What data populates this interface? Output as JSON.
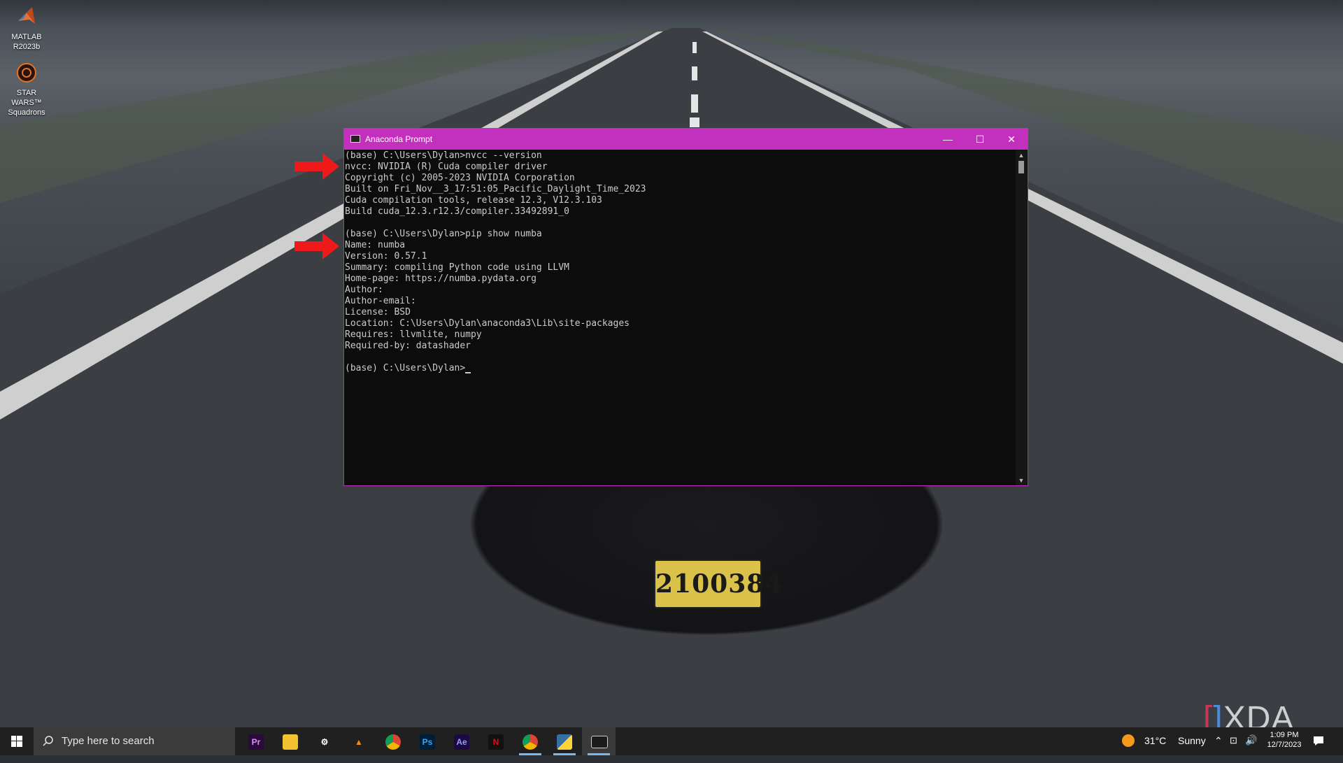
{
  "desktop": {
    "icons": [
      {
        "line1": "MATLAB",
        "line2": "R2023b"
      },
      {
        "line1": "STAR WARS™",
        "line2": "Squadrons"
      }
    ],
    "plate_number": "2100384"
  },
  "window": {
    "title": "Anaconda Prompt",
    "controls": {
      "minimize": "—",
      "maximize": "☐",
      "close": "✕"
    },
    "console_lines": [
      "(base) C:\\Users\\Dylan>nvcc --version",
      "nvcc: NVIDIA (R) Cuda compiler driver",
      "Copyright (c) 2005-2023 NVIDIA Corporation",
      "Built on Fri_Nov__3_17:51:05_Pacific_Daylight_Time_2023",
      "Cuda compilation tools, release 12.3, V12.3.103",
      "Build cuda_12.3.r12.3/compiler.33492891_0",
      "",
      "(base) C:\\Users\\Dylan>pip show numba",
      "Name: numba",
      "Version: 0.57.1",
      "Summary: compiling Python code using LLVM",
      "Home-page: https://numba.pydata.org",
      "Author:",
      "Author-email:",
      "License: BSD",
      "Location: C:\\Users\\Dylan\\anaconda3\\Lib\\site-packages",
      "Requires: llvmlite, numpy",
      "Required-by: datashader",
      "",
      "(base) C:\\Users\\Dylan>"
    ]
  },
  "watermark": "XDA",
  "taskbar": {
    "search_placeholder": "Type here to search",
    "apps": [
      {
        "name": "premiere",
        "label": "Pr",
        "color": "#2a0a3a",
        "fg": "#e08cff"
      },
      {
        "name": "file-explorer",
        "label": "",
        "color": "#f2c230",
        "fg": "#000"
      },
      {
        "name": "settings",
        "label": "⚙",
        "color": "transparent",
        "fg": "#fff"
      },
      {
        "name": "vlc",
        "label": "▲",
        "color": "transparent",
        "fg": "#f28a10"
      },
      {
        "name": "chrome",
        "label": "",
        "color": "transparent",
        "fg": "#fff"
      },
      {
        "name": "photoshop",
        "label": "Ps",
        "color": "#001e36",
        "fg": "#31a8ff"
      },
      {
        "name": "after-effects",
        "label": "Ae",
        "color": "#1a0a40",
        "fg": "#9999ff"
      },
      {
        "name": "netflix",
        "label": "N",
        "color": "#111",
        "fg": "#e50914"
      },
      {
        "name": "chrome-2",
        "label": "",
        "color": "transparent",
        "fg": "#fff"
      },
      {
        "name": "python",
        "label": "",
        "color": "transparent",
        "fg": "#fff"
      },
      {
        "name": "terminal",
        "label": "",
        "color": "transparent",
        "fg": "#fff"
      }
    ],
    "weather": {
      "temp": "31°C",
      "condition": "Sunny"
    },
    "clock": {
      "time": "1:09 PM",
      "date": "12/7/2023"
    }
  }
}
